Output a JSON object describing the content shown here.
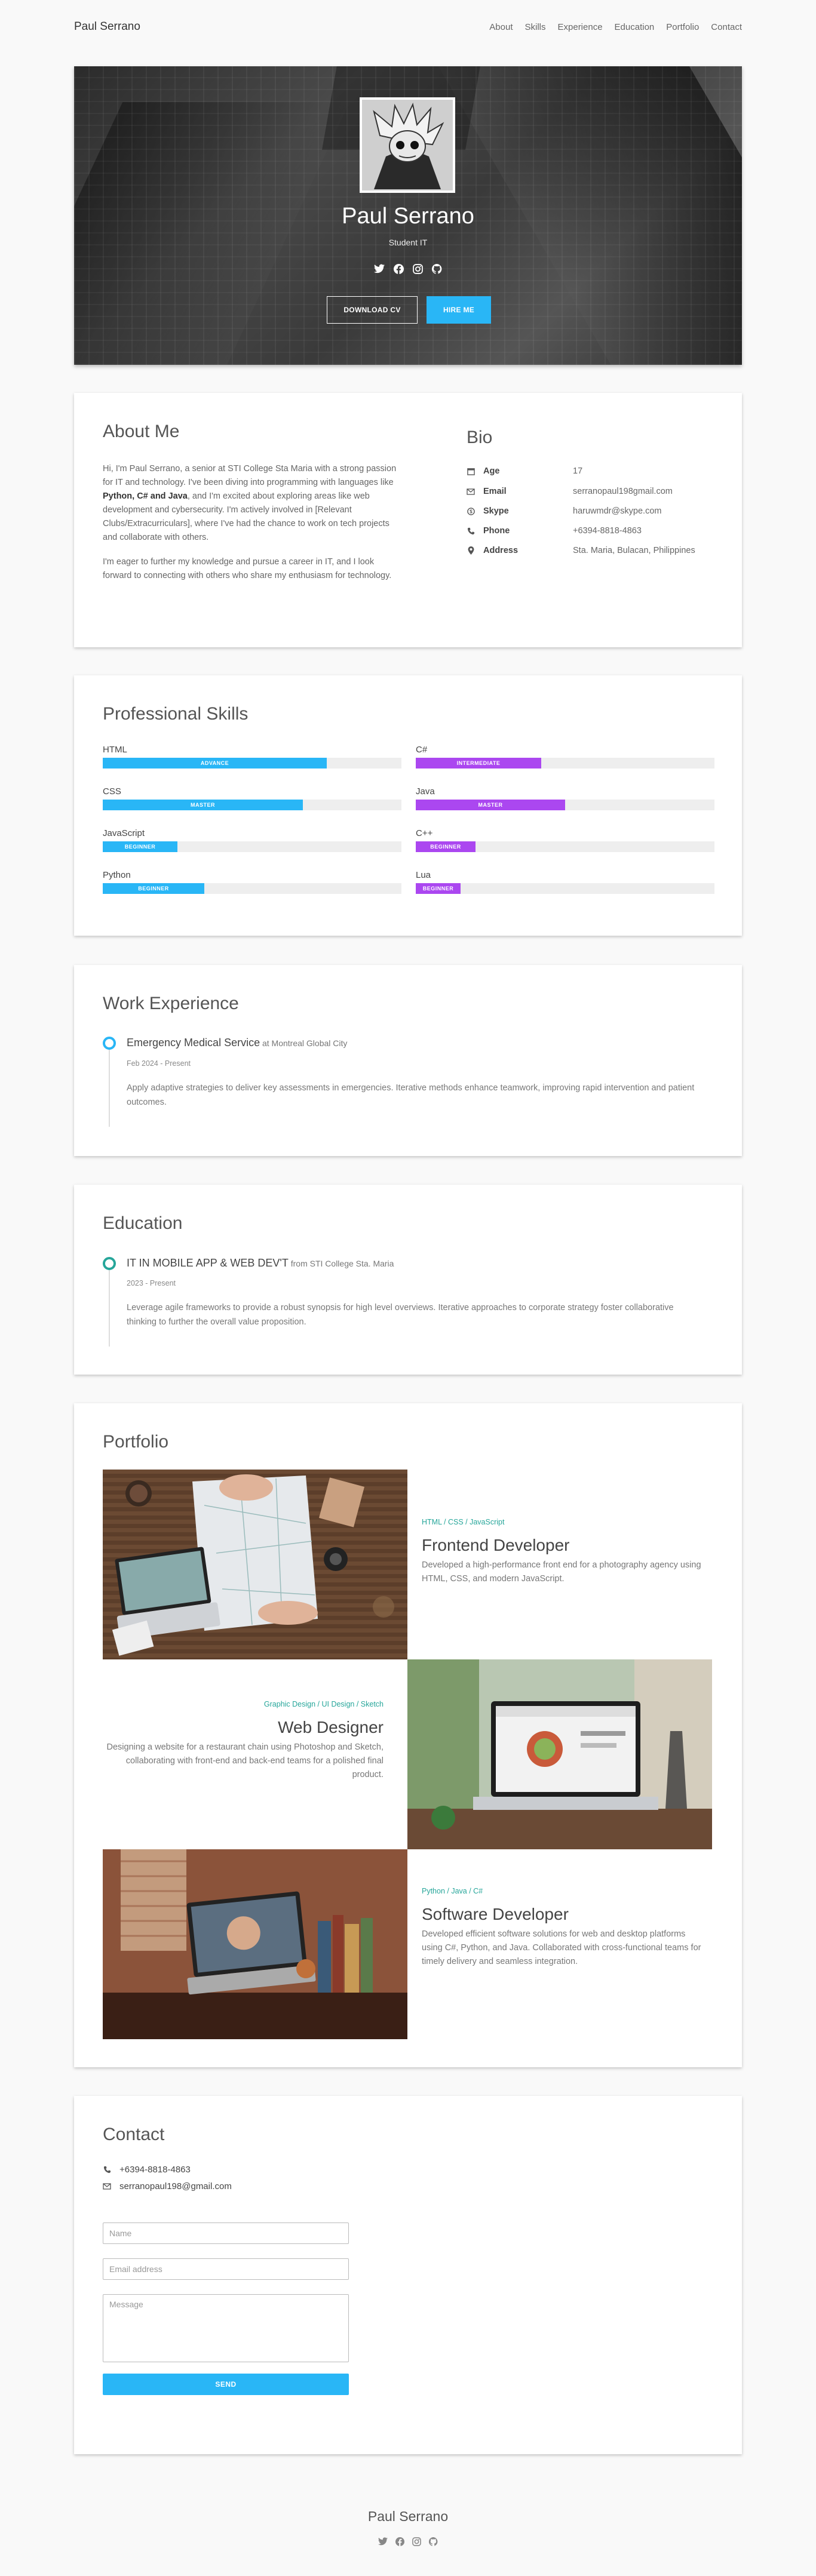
{
  "nav": {
    "brand": "Paul Serrano",
    "links": [
      "About",
      "Skills",
      "Experience",
      "Education",
      "Portfolio",
      "Contact"
    ]
  },
  "hero": {
    "name": "Paul Serrano",
    "role": "Student IT",
    "social_icons": [
      "twitter-icon",
      "facebook-icon",
      "instagram-icon",
      "github-icon"
    ],
    "download_cv": "DOWNLOAD CV",
    "hire_me": "HIRE ME"
  },
  "about": {
    "title": "About Me",
    "p1_a": "Hi, I'm Paul Serrano, a senior at STI College Sta Maria with a strong passion for IT and technology. I've been diving into programming with languages like ",
    "p1_b": "Python, C# and Java",
    "p1_c": ", and I'm excited about exploring areas like web development and cybersecurity. I'm actively involved in [Relevant Clubs/Extracurriculars], where I've had the chance to work on tech projects and collaborate with others.",
    "p2": "I'm eager to further my knowledge and pursue a career in IT, and I look forward to connecting with others who share my enthusiasm for technology."
  },
  "bio": {
    "title": "Bio",
    "rows": [
      {
        "icon": "calendar-icon",
        "key": "Age",
        "value": "17"
      },
      {
        "icon": "envelope-icon",
        "key": "Email",
        "value": "serranopaul198gmail.com"
      },
      {
        "icon": "skype-icon",
        "key": "Skype",
        "value": "haruwmdr@skype.com"
      },
      {
        "icon": "phone-icon",
        "key": "Phone",
        "value": "+6394-8818-4863"
      },
      {
        "icon": "map-marker-icon",
        "key": "Address",
        "value": "Sta. Maria, Bulacan, Philippines"
      }
    ]
  },
  "skills": {
    "title": "Professional Skills",
    "left": [
      {
        "name": "HTML",
        "level": "ADVANCE",
        "percent": 75,
        "color": "#29b6f6"
      },
      {
        "name": "CSS",
        "level": "MASTER",
        "percent": 67,
        "color": "#29b6f6"
      },
      {
        "name": "JavaScript",
        "level": "BEGINNER",
        "percent": 25,
        "color": "#29b6f6"
      },
      {
        "name": "Python",
        "level": "BEGINNER",
        "percent": 34,
        "color": "#29b6f6"
      }
    ],
    "right": [
      {
        "name": "C#",
        "level": "INTERMEDIATE",
        "percent": 42,
        "color": "#ab47f0"
      },
      {
        "name": "Java",
        "level": "MASTER",
        "percent": 50,
        "color": "#ab47f0"
      },
      {
        "name": "C++",
        "level": "BEGINNER",
        "percent": 20,
        "color": "#ab47f0"
      },
      {
        "name": "Lua",
        "level": "BEGINNER",
        "percent": 15,
        "color": "#ab47f0"
      }
    ]
  },
  "experience": {
    "title": "Work Experience",
    "role": "Emergency Medical Service",
    "at": " at Montreal Global City",
    "date": "Feb 2024 - Present",
    "desc": "Apply adaptive strategies to deliver key assessments in emergencies. Iterative methods enhance teamwork, improving rapid intervention and patient outcomes."
  },
  "education": {
    "title": "Education",
    "course": "IT IN MOBILE APP & WEB DEV'T",
    "at": " from STI College Sta. Maria",
    "date": "2023 - Present",
    "desc": "Leverage agile frameworks to provide a robust synopsis for high level overviews. Iterative approaches to corporate strategy foster collaborative thinking to further the overall value proposition."
  },
  "portfolio": {
    "title": "Portfolio",
    "items": [
      {
        "tags": "HTML / CSS / JavaScript",
        "title": "Frontend Developer",
        "desc": "Developed a high-performance front end for a photography agency using HTML, CSS, and modern JavaScript."
      },
      {
        "tags": "Graphic Design / UI Design / Sketch",
        "title": "Web Designer",
        "desc": "Designing a website for a restaurant chain using Photoshop and Sketch, collaborating with front-end and back-end teams for a polished final product."
      },
      {
        "tags": "Python / Java / C#",
        "title": "Software Developer",
        "desc": "Developed efficient software solutions for web and desktop platforms using C#, Python, and Java. Collaborated with cross-functional teams for timely delivery and seamless integration."
      }
    ]
  },
  "contact": {
    "title": "Contact",
    "phone": "+6394-8818-4863",
    "email": "serranopaul198@gmail.com",
    "name_placeholder": "Name",
    "email_placeholder": "Email address",
    "message_placeholder": "Message",
    "send": "SEND"
  },
  "footer": {
    "name": "Paul Serrano",
    "social_icons": [
      "twitter-icon",
      "facebook-icon",
      "instagram-icon",
      "github-icon"
    ]
  },
  "colors": {
    "accent_blue": "#29b6f6",
    "accent_purple": "#ab47f0",
    "tag_green": "#26a69a"
  }
}
